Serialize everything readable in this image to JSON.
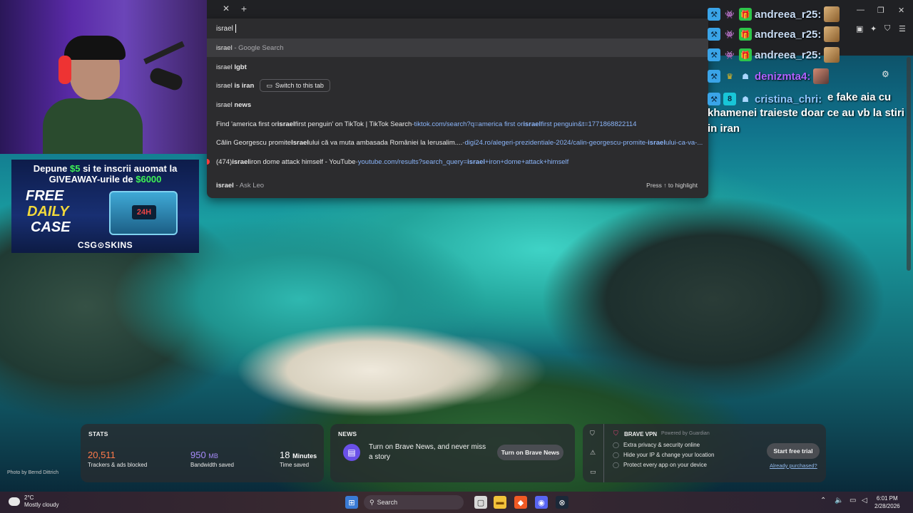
{
  "omnibox": {
    "input_value": "israel ",
    "suggestions": [
      {
        "query": "israel",
        "suffix": "- Google Search"
      },
      {
        "query": "israel",
        "bold": "lgbt"
      },
      {
        "query": "israel",
        "bold": "is iran",
        "chip": "Switch to this tab"
      },
      {
        "query": "israel",
        "bold": "news"
      },
      {
        "prefix": "Find 'america first or ",
        "bold": "israel",
        "mid": " first penguin' on TikTok | TikTok Search",
        "sep": " - ",
        "url": "tiktok.com/search?q=america first or ",
        "url_bold": "israel",
        "url_tail": " first penguin&t=1771868822114"
      },
      {
        "prefix": "Călin Georgescu promite ",
        "bold": "Israel",
        "mid": "ului că va muta ambasada României la Ierusalim....",
        "sep": " - ",
        "url": "digi24.ro/alegeri-prezidentiale-2024/calin-georgescu-promite-",
        "url_bold": "israel",
        "url_tail": "ului-ca-va-..."
      },
      {
        "prefix": "(474) ",
        "bold": "israel",
        "mid": " iron dome attack himself - YouTube",
        "sep": " - ",
        "url": "youtube.com/results?search_query=",
        "url_bold": "israel",
        "url_tail": "+iron+dome+attack+himself"
      },
      {
        "bold": "israel",
        "suffix": "- Ask Leo",
        "hint": "Press ↑ to highlight"
      }
    ]
  },
  "ad": {
    "line1_a": "Depune ",
    "line1_money": "$5",
    "line1_b": " si te inscrii auomat la",
    "line2_a": "GIVEAWAY-urile de ",
    "line2_money": "$6000",
    "free": "FREE",
    "daily": "DAILY",
    "case": "CASE",
    "box_label": "24H",
    "brand": "CSG⊙SKINS"
  },
  "chat": {
    "rows": [
      {
        "name": "andreea_r25:",
        "color": "#c9ddf5"
      },
      {
        "name": "andreea_r25:",
        "color": "#c9ddf5"
      },
      {
        "name": "andreea_r25:",
        "color": "#c9ddf5"
      },
      {
        "name": "denizmta4:",
        "color": "#b061ff"
      },
      {
        "name": "cristina_chri:",
        "color": "#8fc6ff"
      }
    ],
    "message": "e fake aia cu khamenei traieste doar ce au vb la stiri in iran"
  },
  "widgets": {
    "stats": {
      "title": "STATS",
      "trackers_value": "20,511",
      "trackers_label": "Trackers & ads blocked",
      "bandwidth_value": "950",
      "bandwidth_unit": "MB",
      "bandwidth_label": "Bandwidth saved",
      "time_value": "18",
      "time_unit": "Minutes",
      "time_label": "Time saved"
    },
    "news": {
      "title": "NEWS",
      "text": "Turn on Brave News, and never miss a story",
      "button": "Turn on Brave News"
    },
    "vpn": {
      "title": "BRAVE VPN",
      "powered": "Powered by  Guardian",
      "items": [
        "Extra privacy & security online",
        "Hide your IP & change your location",
        "Protect every app on your device"
      ],
      "button": "Start free trial",
      "link": "Already purchased?"
    },
    "photo_credit": "Photo by Bernd Dittrich"
  },
  "taskbar": {
    "temp": "2°C",
    "condition": "Mostly cloudy",
    "search": "Search",
    "time": "6:01 PM",
    "date": "2/28/2026"
  },
  "colors": {
    "accent_green": "#3ef255",
    "url_blue": "#8ab4f8",
    "brave_purple": "#6a50e8"
  }
}
